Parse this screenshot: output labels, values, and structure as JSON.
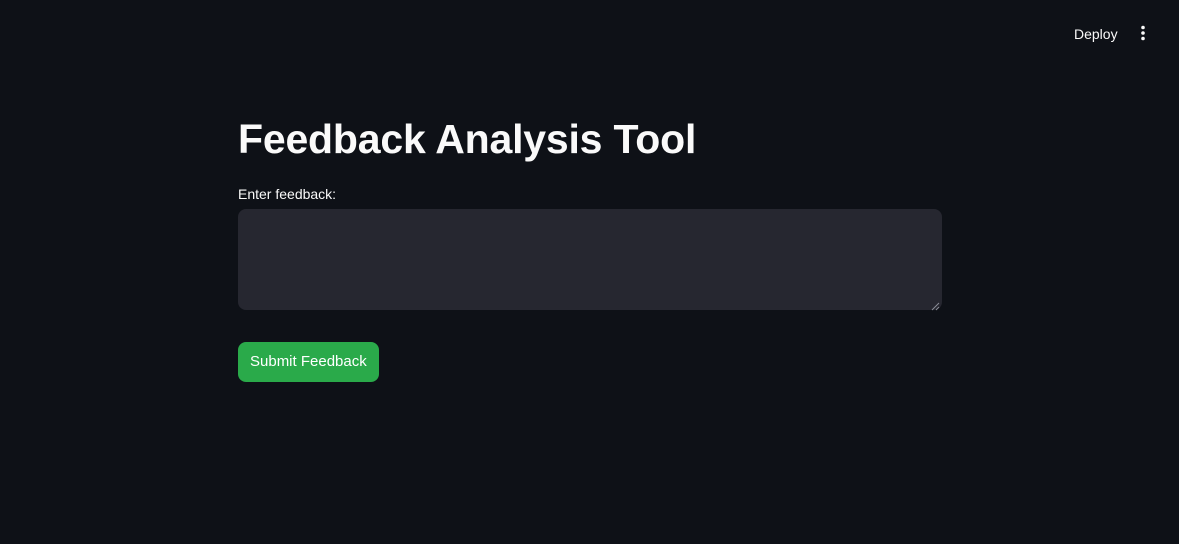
{
  "header": {
    "deploy_label": "Deploy",
    "menu_icon": "vertical-ellipsis-icon"
  },
  "main": {
    "title": "Feedback Analysis Tool",
    "feedback_label": "Enter feedback:",
    "feedback_value": "",
    "feedback_placeholder": "",
    "submit_label": "Submit Feedback"
  },
  "colors": {
    "background": "#0e1117",
    "input_background": "#262730",
    "primary_button": "#2aaa4a",
    "text": "#fafafa"
  }
}
